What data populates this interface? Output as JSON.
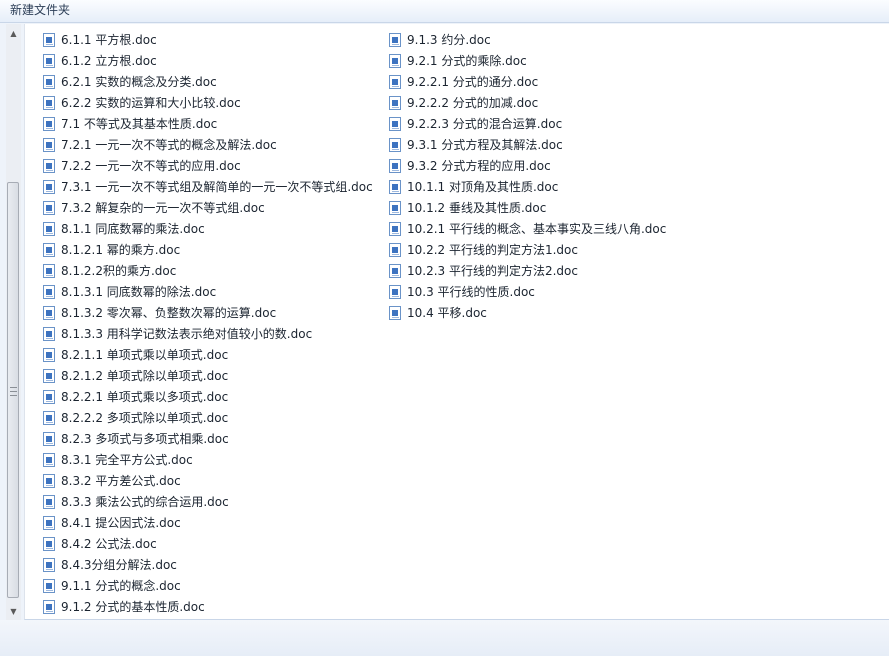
{
  "window": {
    "title": "新建文件夹"
  },
  "icons": {
    "file_icon": "word-doc-icon",
    "scroll_up": "▲",
    "scroll_down": "▼"
  },
  "colors": {
    "icon_blue": "#3d73c0",
    "title_bar": "#e6eef9",
    "list_background": "#ffffff"
  },
  "files": {
    "col1": [
      "6.1.1 平方根.doc",
      "6.1.2 立方根.doc",
      "6.2.1 实数的概念及分类.doc",
      "6.2.2 实数的运算和大小比较.doc",
      "7.1 不等式及其基本性质.doc",
      "7.2.1 一元一次不等式的概念及解法.doc",
      "7.2.2 一元一次不等式的应用.doc",
      "7.3.1 一元一次不等式组及解简单的一元一次不等式组.doc",
      "7.3.2 解复杂的一元一次不等式组.doc",
      "8.1.1 同底数幂的乘法.doc",
      "8.1.2.1 幂的乘方.doc",
      "8.1.2.2积的乘方.doc",
      "8.1.3.1 同底数幂的除法.doc",
      "8.1.3.2 零次幂、负整数次幂的运算.doc",
      "8.1.3.3 用科学记数法表示绝对值较小的数.doc",
      "8.2.1.1 单项式乘以单项式.doc",
      "8.2.1.2 单项式除以单项式.doc",
      "8.2.2.1 单项式乘以多项式.doc",
      "8.2.2.2 多项式除以单项式.doc",
      "8.2.3 多项式与多项式相乘.doc",
      "8.3.1 完全平方公式.doc",
      "8.3.2 平方差公式.doc",
      "8.3.3 乘法公式的综合运用.doc",
      "8.4.1 提公因式法.doc",
      "8.4.2 公式法.doc",
      "8.4.3分组分解法.doc",
      "9.1.1 分式的概念.doc",
      "9.1.2 分式的基本性质.doc"
    ],
    "col2": [
      "9.1.3 约分.doc",
      "9.2.1 分式的乘除.doc",
      "9.2.2.1 分式的通分.doc",
      "9.2.2.2 分式的加减.doc",
      "9.2.2.3 分式的混合运算.doc",
      "9.3.1 分式方程及其解法.doc",
      "9.3.2 分式方程的应用.doc",
      "10.1.1 对顶角及其性质.doc",
      "10.1.2 垂线及其性质.doc",
      "10.2.1 平行线的概念、基本事实及三线八角.doc",
      "10.2.2 平行线的判定方法1.doc",
      "10.2.3 平行线的判定方法2.doc",
      "10.3 平行线的性质.doc",
      "10.4 平移.doc"
    ]
  }
}
